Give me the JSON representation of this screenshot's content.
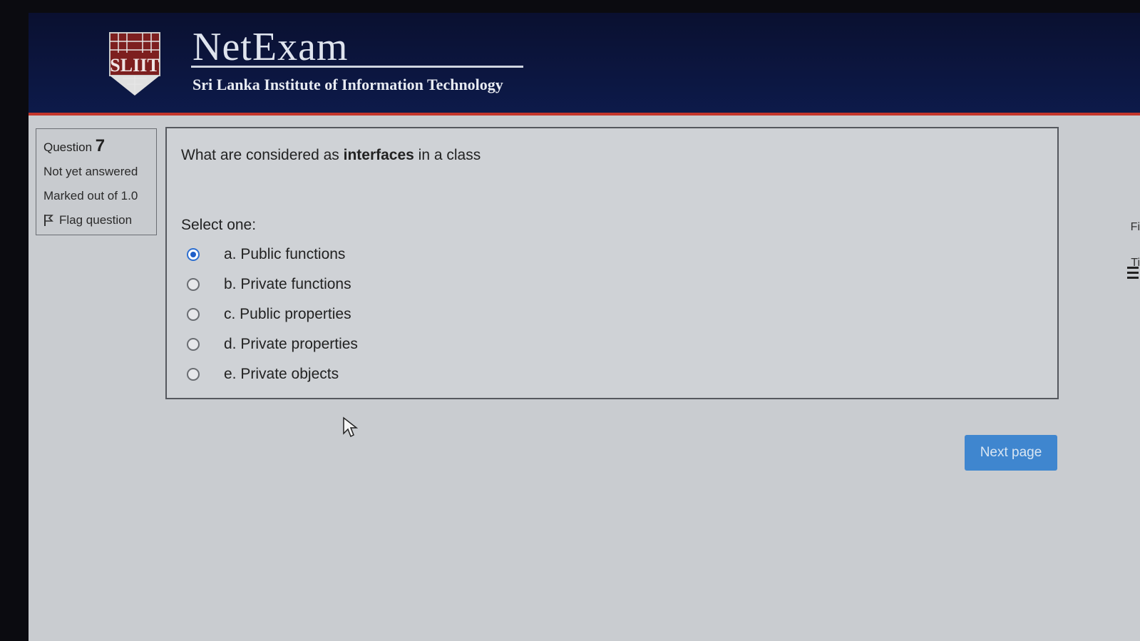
{
  "header": {
    "logo_text": "SLIIT",
    "title": "NetExam",
    "subtitle": "Sri Lanka Institute of Information Technology"
  },
  "info": {
    "question_label": "Question",
    "question_number": "7",
    "status": "Not yet answered",
    "marks": "Marked out of 1.0",
    "flag_label": "Flag question"
  },
  "question": {
    "text_before": "What are considered as ",
    "text_bold": "interfaces",
    "text_after": " in a class",
    "select_label": "Select one:",
    "options": [
      {
        "label": "a.  Public functions",
        "selected": true
      },
      {
        "label": "b. Private functions",
        "selected": false
      },
      {
        "label": "c. Public properties",
        "selected": false
      },
      {
        "label": "d. Private properties",
        "selected": false
      },
      {
        "label": "e. Private objects",
        "selected": false
      }
    ]
  },
  "next_button": "Next page",
  "side": {
    "partial_1": "Fi",
    "partial_2": "Ti"
  },
  "colors": {
    "header_bg": "#0d1a4a",
    "accent_red": "#c4362b",
    "button_blue": "#3f86cf",
    "radio_selected": "#1f5fc9"
  },
  "icons": {
    "flag": "flag-icon",
    "cursor": "mouse-pointer-icon",
    "menu": "hamburger-icon"
  }
}
